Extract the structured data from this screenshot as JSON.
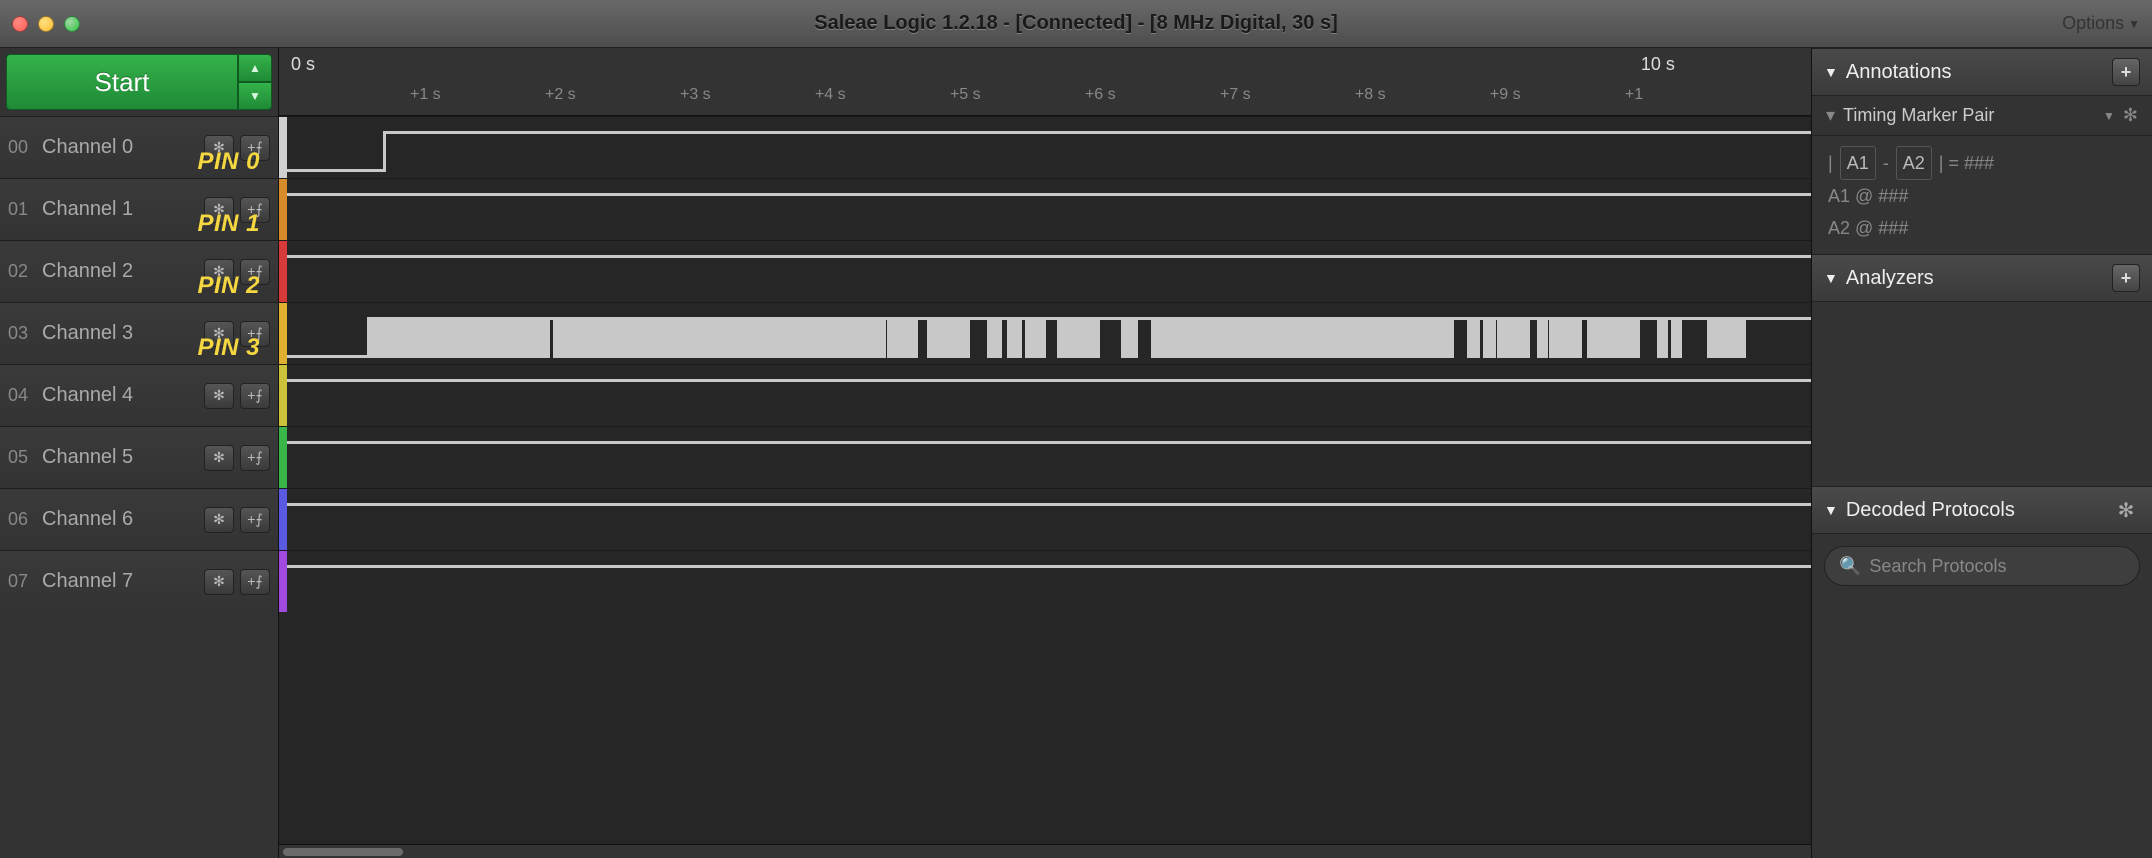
{
  "window": {
    "title": "Saleae Logic 1.2.18 - [Connected] - [8 MHz Digital, 30 s]",
    "options_label": "Options"
  },
  "start_button": {
    "label": "Start"
  },
  "timeline": {
    "major_0": "0 s",
    "major_10": "10 s",
    "minors": [
      "+1 s",
      "+2 s",
      "+3 s",
      "+4 s",
      "+5 s",
      "+6 s",
      "+7 s",
      "+8 s",
      "+9 s",
      "+1"
    ]
  },
  "channels": [
    {
      "num": "00",
      "name": "Channel 0",
      "pin": "PIN 0",
      "color": "#d0d0d0"
    },
    {
      "num": "01",
      "name": "Channel 1",
      "pin": "PIN 1",
      "color": "#d88b2a"
    },
    {
      "num": "02",
      "name": "Channel 2",
      "pin": "PIN 2",
      "color": "#d83a3a"
    },
    {
      "num": "03",
      "name": "Channel 3",
      "pin": "PIN 3",
      "color": "#e0b030"
    },
    {
      "num": "04",
      "name": "Channel 4",
      "pin": "",
      "color": "#c9c23a"
    },
    {
      "num": "05",
      "name": "Channel 5",
      "pin": "",
      "color": "#3ab54a"
    },
    {
      "num": "06",
      "name": "Channel 6",
      "pin": "",
      "color": "#5a5ae0"
    },
    {
      "num": "07",
      "name": "Channel 7",
      "pin": "",
      "color": "#a04ae0"
    }
  ],
  "annotations": {
    "header": "Annotations",
    "marker_pair": "Timing Marker Pair",
    "formula_a1": "A1",
    "formula_a2": "A2",
    "formula_eq": " = ###",
    "a1_line": "A1   @   ###",
    "a2_line": "A2   @   ###"
  },
  "analyzers": {
    "header": "Analyzers"
  },
  "decoded": {
    "header": "Decoded Protocols",
    "search_placeholder": "Search Protocols"
  }
}
